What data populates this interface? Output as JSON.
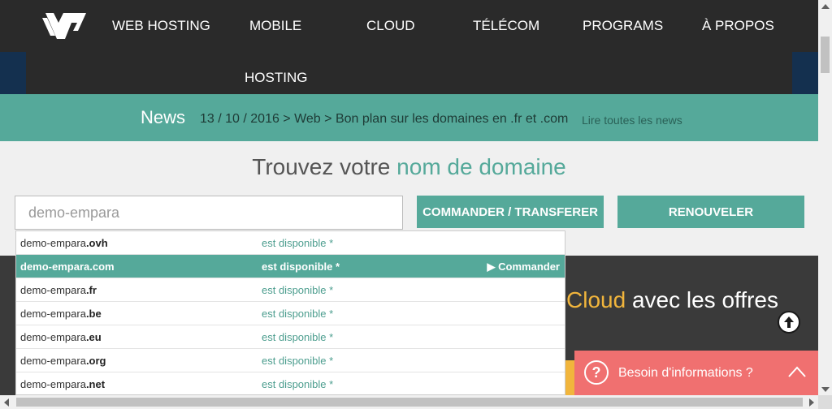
{
  "nav": {
    "items": [
      {
        "label": "WEB HOSTING"
      },
      {
        "label": "MOBILE"
      },
      {
        "label": "HOSTING"
      },
      {
        "label": "CLOUD"
      },
      {
        "label": "TÉLÉCOM"
      },
      {
        "label": "PROGRAMS"
      },
      {
        "label": "À PROPOS"
      }
    ]
  },
  "news": {
    "title": "News",
    "item": "13 / 10 / 2016 > Web > Bon plan sur les domaines en .fr et .com",
    "all_link": "Lire toutes les news"
  },
  "search": {
    "heading_prefix": "Trouvez votre",
    "heading_highlight": "nom de domaine",
    "value": "demo-empara",
    "order_button": "COMMANDER / TRANSFERER",
    "renew_button": "RENOUVELER"
  },
  "suggestions": {
    "base": "demo-empara",
    "status": "est disponible *",
    "action": "Commander",
    "items": [
      {
        "tld": ".ovh"
      },
      {
        "tld": ".com"
      },
      {
        "tld": ".fr"
      },
      {
        "tld": ".be"
      },
      {
        "tld": ".eu"
      },
      {
        "tld": ".org"
      },
      {
        "tld": ".net"
      }
    ]
  },
  "promo": {
    "cloud": "Cloud",
    "rest": "avec les offres"
  },
  "help": {
    "text": "Besoin d'informations ?"
  },
  "colors": {
    "teal": "#55a99a",
    "dark": "#2a2a2a",
    "navy": "#14304f",
    "yellow": "#f1b53c",
    "help": "#f07070"
  }
}
